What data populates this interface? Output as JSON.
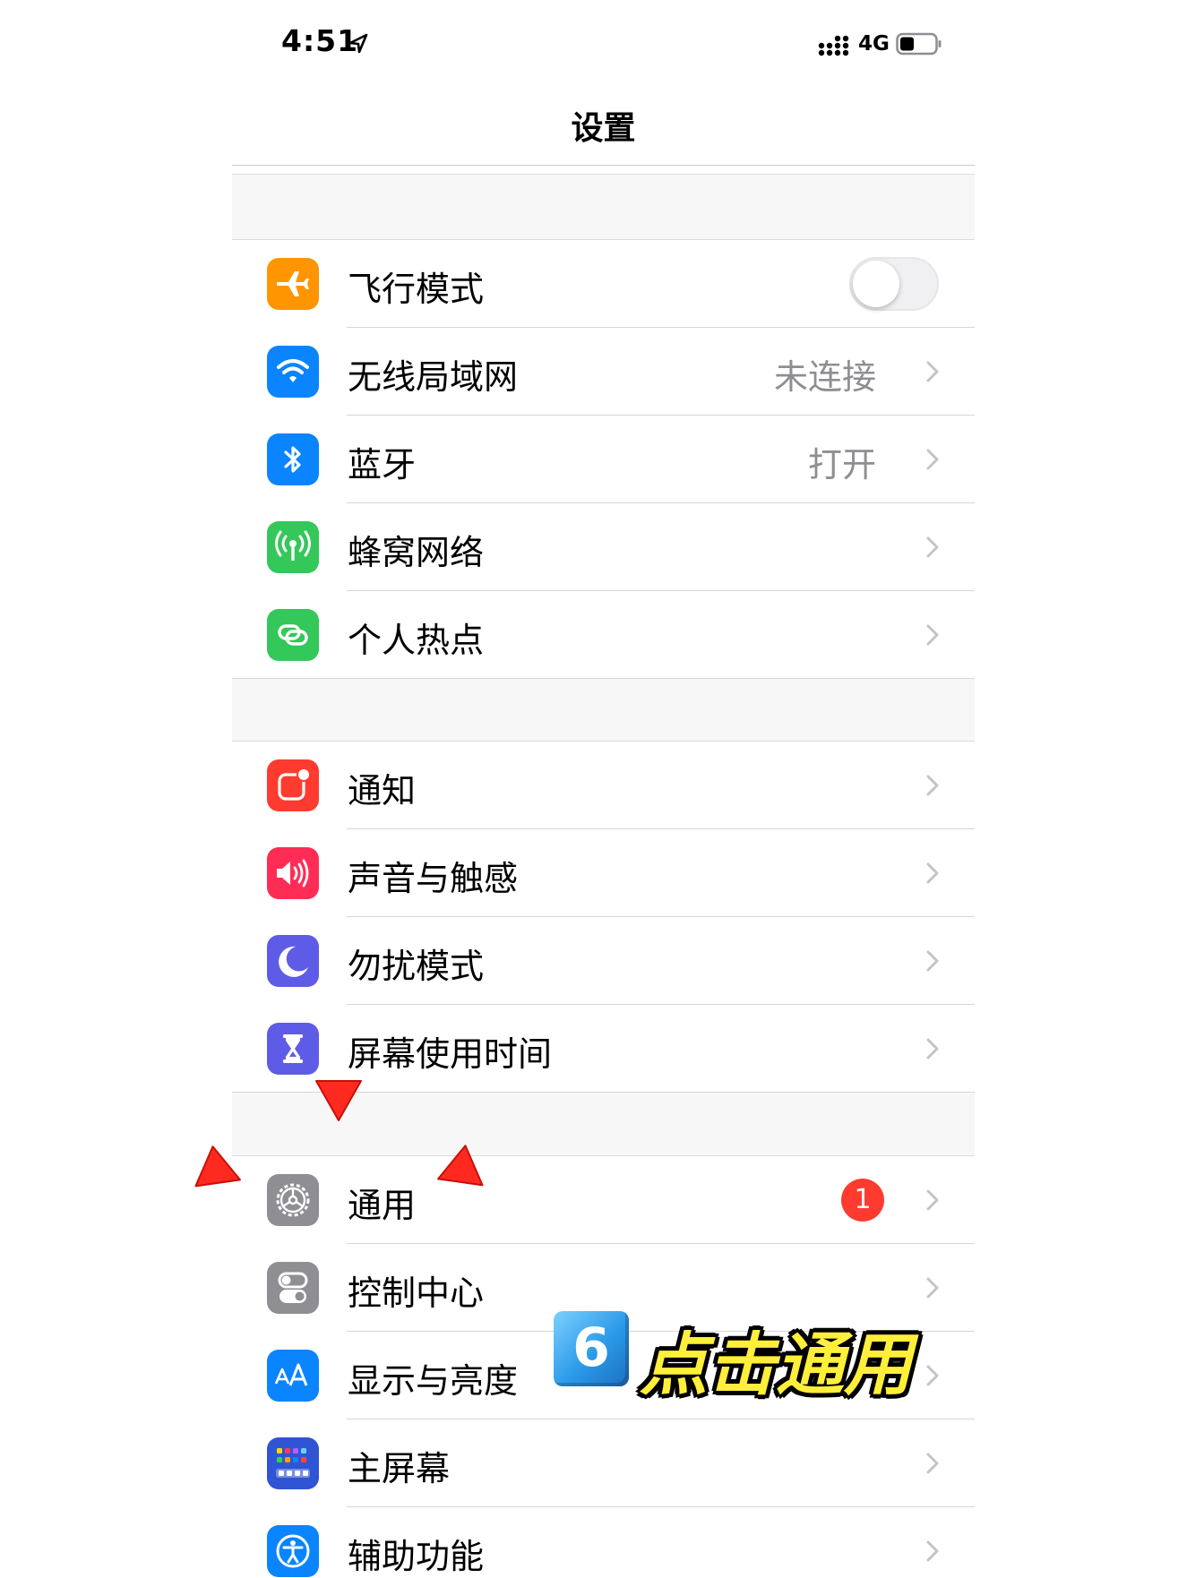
{
  "status_bar": {
    "time": "4:51",
    "network": "4G"
  },
  "nav": {
    "title": "设置"
  },
  "groups": [
    {
      "rows": [
        {
          "label": "飞行模式",
          "icon": "airplane-icon",
          "color": "#FF9500",
          "control": "toggle",
          "toggle_on": false
        },
        {
          "label": "无线局域网",
          "icon": "wifi-icon",
          "color": "#0A84FF",
          "value": "未连接"
        },
        {
          "label": "蓝牙",
          "icon": "bluetooth-icon",
          "color": "#0A84FF",
          "value": "打开"
        },
        {
          "label": "蜂窝网络",
          "icon": "antenna-icon",
          "color": "#34C759"
        },
        {
          "label": "个人热点",
          "icon": "link-icon",
          "color": "#34C759"
        }
      ]
    },
    {
      "rows": [
        {
          "label": "通知",
          "icon": "notification-icon",
          "color": "#FF3B30"
        },
        {
          "label": "声音与触感",
          "icon": "speaker-icon",
          "color": "#FF2D55"
        },
        {
          "label": "勿扰模式",
          "icon": "moon-icon",
          "color": "#5E5CE6"
        },
        {
          "label": "屏幕使用时间",
          "icon": "hourglass-icon",
          "color": "#5E5CE6"
        }
      ]
    },
    {
      "rows": [
        {
          "label": "通用",
          "icon": "gear-icon",
          "color": "#8E8E93",
          "badge": "1"
        },
        {
          "label": "控制中心",
          "icon": "switches-icon",
          "color": "#8E8E93"
        },
        {
          "label": "显示与亮度",
          "icon": "text-size-icon",
          "color": "#0A84FF"
        },
        {
          "label": "主屏幕",
          "icon": "home-grid-icon",
          "color": "#2F55D4"
        },
        {
          "label": "辅助功能",
          "icon": "accessibility-icon",
          "color": "#0A84FF"
        }
      ]
    }
  ],
  "annotation": {
    "step_number": "6",
    "text": "点击通用",
    "arrow_color": "#FF2A1F"
  }
}
